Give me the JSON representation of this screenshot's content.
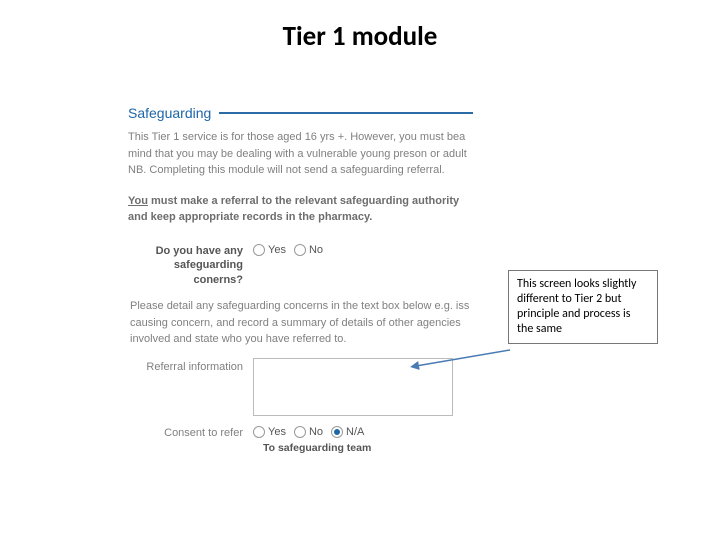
{
  "title": "Tier 1 module",
  "section": {
    "heading": "Safeguarding",
    "intro_line1": "This Tier 1 service is for those aged 16 yrs +. However, you must bea",
    "intro_line2": "mind that you may be dealing with a vulnerable young preson or adult",
    "intro_line3": "NB. Completing this module will not send a safeguarding referral.",
    "note_line1_underlined": "You",
    "note_line1_rest": " must make a referral to the relevant safeguarding authority",
    "note_line2": "and keep appropriate records in the pharmacy."
  },
  "form": {
    "q1_label": "Do you have any safeguarding conerns?",
    "yes": "Yes",
    "no": "No",
    "na": "N/A",
    "helper": "Please detail any safeguarding concerns in the text box below e.g. iss causing concern, and record a summary of details of other agencies involved and state who you have referred to.",
    "referral_label": "Referral information",
    "consent_label": "Consent to refer",
    "consent_sub": "To safeguarding team"
  },
  "callout": {
    "text": "This screen looks slightly different to Tier 2 but principle and process is the same"
  }
}
